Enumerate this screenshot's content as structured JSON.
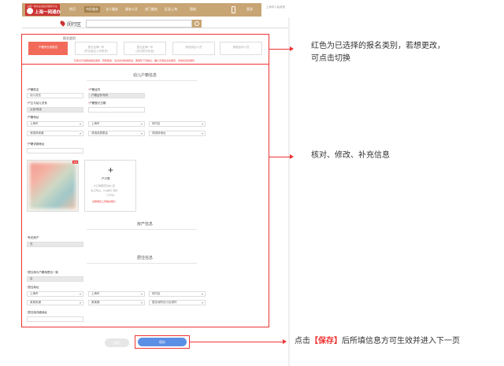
{
  "header": {
    "logo_small": "全国一体化在线政务服务平台",
    "logo_title": "上海一网通办",
    "nav": [
      "首页",
      "市民服务",
      "法人服务",
      "政务公开",
      "部门服务",
      "区县上海",
      "帮助"
    ],
    "login": "登录",
    "side_note": "上海市人民政府"
  },
  "location": {
    "city": "闵行区",
    "search_placeholder": ""
  },
  "category": {
    "title": "报名类别",
    "tabs": [
      {
        "line1": "户籍所在地报名",
        "line2": ""
      },
      {
        "line1": "居住证满一年",
        "line2": "(符合就近入学条件)"
      },
      {
        "line1": "居住证满一年",
        "line2": "(未达积分标准)"
      },
      {
        "line1": "其他持证人员",
        "line2": ""
      },
      {
        "line1": "港澳台侨人员",
        "line2": ""
      }
    ],
    "hint": "红色为已选择的报名类别，若想更改，请点击切换类别后，再填写下列信息，确认无误后点击保存，系统将自动保存"
  },
  "child_section": {
    "title": "幼儿户籍信息",
    "name_label": "户籍姓名",
    "name_value": "幼儿姓名",
    "id_label": "户籍证件",
    "id_value": "户籍证件号码",
    "relation_label": "户主与幼儿关系",
    "relation_value": "父亲/母亲",
    "household_label": "户籍登记日期",
    "household_value": "",
    "address_label": "户籍地址",
    "province": "上海市",
    "city": "上海市",
    "district": "闵行区",
    "street": "请选择街道",
    "road": "请选择居委会",
    "community": "请选择地址",
    "detail_label": "户籍详细地址",
    "detail_value": ""
  },
  "upload": {
    "photo_tag": "示例",
    "label": "户口簿",
    "lines": [
      "户口簿首页及幼儿页",
      "请上传jpg、png格式, 照片",
      "小于5M"
    ],
    "red_note": "请按规定上传相关照片"
  },
  "property_section": {
    "title": "房产信息",
    "label": "有无房产",
    "value": "无"
  },
  "residence_section": {
    "title": "居住信息",
    "same_label": "居住地与户籍地是否一致",
    "same_value": "否",
    "address_label": "居住地址",
    "province": "上海市",
    "city": "上海市",
    "district": "闵行区",
    "street": "某某街道",
    "road": "某某路",
    "community": "居住地所在小区或村",
    "detail_label": "居住地详细地址",
    "detail_value": ""
  },
  "buttons": {
    "back": "返回",
    "save": "保存"
  },
  "annotations": {
    "a1_line1": "红色为已选择的报名类别，若想更改，",
    "a1_line2": "可点击切换",
    "a2": "核对、修改、补充信息",
    "a3_pre": "点击",
    "a3_bold": "【保存】",
    "a3_post": "后所填信息方可生效并进入下一页"
  },
  "colors": {
    "brand": "#c8a574",
    "selected": "#f26b5a",
    "annotation": "#e33333",
    "save": "#5b8fe6"
  }
}
